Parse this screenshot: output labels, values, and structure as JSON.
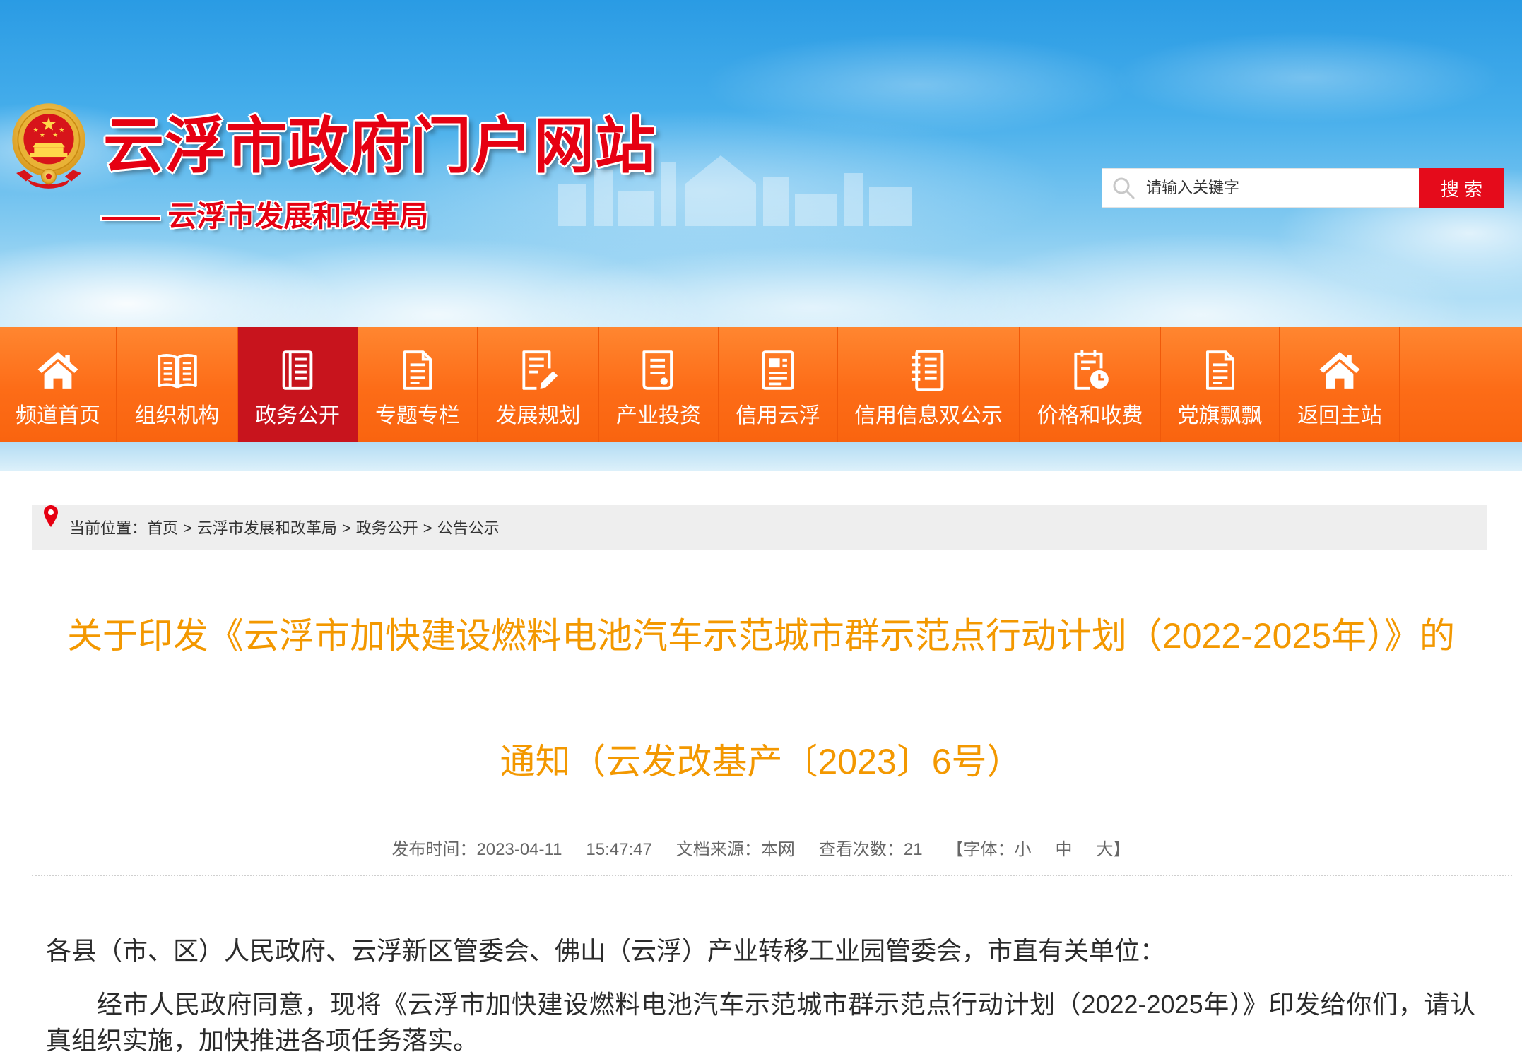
{
  "header": {
    "emblem": "national-emblem-icon",
    "site_title": "云浮市政府门户网站",
    "sub_title": "—— 云浮市发展和改革局",
    "search": {
      "icon": "search-icon",
      "placeholder": "请输入关键字",
      "button_label": "搜 索"
    }
  },
  "nav": {
    "items": [
      {
        "label": "频道首页",
        "icon": "home-icon"
      },
      {
        "label": "组织机构",
        "icon": "book-icon"
      },
      {
        "label": "政务公开",
        "icon": "document-list-icon",
        "active": true
      },
      {
        "label": "专题专栏",
        "icon": "document-icon"
      },
      {
        "label": "发展规划",
        "icon": "edit-document-icon"
      },
      {
        "label": "产业投资",
        "icon": "file-stack-icon"
      },
      {
        "label": "信用云浮",
        "icon": "news-icon"
      },
      {
        "label": "信用信息双公示",
        "icon": "notebook-icon"
      },
      {
        "label": "价格和收费",
        "icon": "clock-document-icon"
      },
      {
        "label": "党旗飘飘",
        "icon": "document-icon"
      },
      {
        "label": "返回主站",
        "icon": "home-icon"
      }
    ]
  },
  "breadcrumb": {
    "icon": "location-pin-icon",
    "prefix": "当前位置：",
    "separator": ">",
    "items": [
      "首页",
      "云浮市发展和改革局",
      "政务公开",
      "公告公示"
    ]
  },
  "article": {
    "title_lines": [
      "关于印发《云浮市加快建设燃料电池汽车示范城市群示范点行动计划（2022-2025年）》的",
      "通知（云发改基产〔2023〕6号）"
    ],
    "meta": {
      "publish_label": "发布时间：",
      "publish_date": "2023-04-11",
      "publish_time": "15:47:47",
      "source_label": "文档来源：",
      "source": "本网",
      "views_label": "查看次数：",
      "views": 21,
      "font_open": "【字体：",
      "font_sizes": [
        "小",
        "中",
        "大"
      ],
      "font_close": "】"
    },
    "salutation": "各县（市、区）人民政府、云浮新区管委会、佛山（云浮）产业转移工业园管委会，市直有关单位：",
    "paragraphs": [
      "经市人民政府同意，现将《云浮市加快建设燃料电池汽车示范城市群示范点行动计划（2022-2025年）》印发给你们，请认真组织实施，加快推进各项任务落实。"
    ]
  },
  "colors": {
    "site_title_red": "#e60012",
    "nav_orange": "#fd6c17",
    "nav_active": "#c8141d",
    "search_button": "#e50b1b",
    "article_title": "#f39800",
    "breadcrumb_bg": "#eeeeee"
  }
}
